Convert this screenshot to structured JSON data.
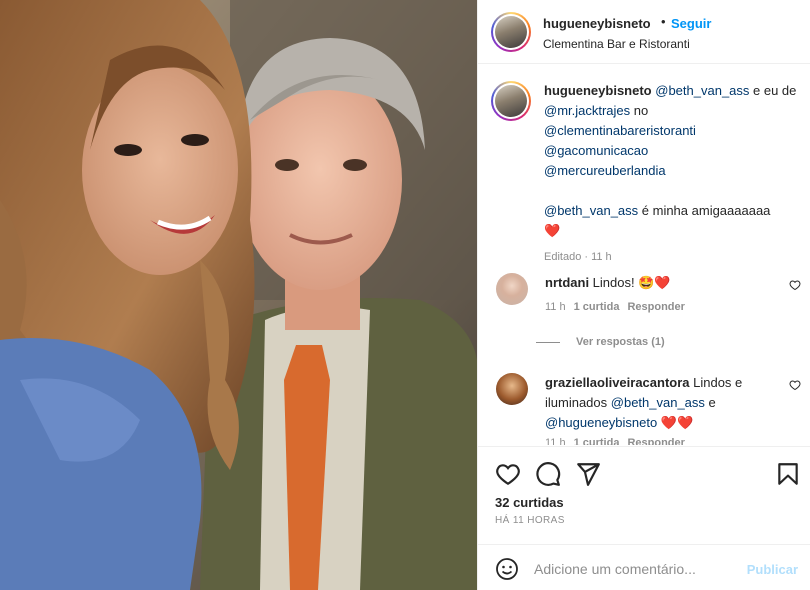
{
  "post": {
    "username": "hugueneybisneto",
    "follow_label": "Seguir",
    "separator": "•",
    "location": "Clementina Bar e Ristoranti",
    "photo_icon": "post-photo"
  },
  "caption": {
    "username": "hugueneybisneto",
    "mention1": "@beth_van_ass",
    "text1": " e eu de ",
    "mention2": "@mr.jacktrajes",
    "text2": " no",
    "mention3": "@clementinabareristoranti",
    "mention4": "@gacomunicacao",
    "mention5": "@mercureuberlandia",
    "mention6": "@beth_van_ass",
    "text3": " é minha amigaaaaaaa",
    "heart": "❤️",
    "edited": "Editado · 11 h"
  },
  "comments": [
    {
      "username": "nrtdani",
      "text": " Lindos! ",
      "emoji": "🤩❤️",
      "time": "11 h",
      "likes": "1 curtida",
      "reply": "Responder",
      "view_replies": "Ver respostas (1)"
    },
    {
      "username": "graziellaoliveiracantora",
      "text1": " Lindos e iluminados ",
      "mention1": "@beth_van_ass",
      "text2": " e ",
      "mention2": "@hugueneybisneto",
      "emoji": " ❤️❤️",
      "time": "11 h",
      "likes": "1 curtida",
      "reply": "Responder"
    }
  ],
  "actions": {
    "likes_count": "32 curtidas",
    "time_ago": "HÁ 11 HORAS"
  },
  "comment_box": {
    "placeholder": "Adicione um comentário...",
    "publish_label": "Publicar"
  },
  "colors": {
    "accent": "#0095f6",
    "mention": "#00376b",
    "heart": "#ed1c3a",
    "muted": "#8e8e8e"
  }
}
